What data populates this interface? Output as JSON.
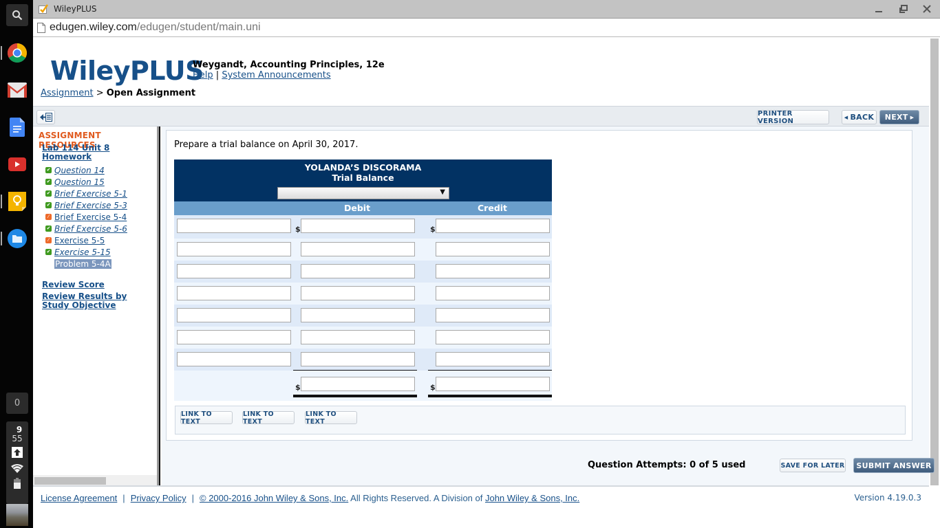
{
  "os_shelf": {
    "apps": [
      "Search",
      "Chrome",
      "Gmail",
      "Docs",
      "YouTube",
      "Keep",
      "Files"
    ],
    "notification_count": "0",
    "clock_hour": "9",
    "clock_minute": "55"
  },
  "window": {
    "tab_title": "WileyPLUS",
    "url_host": "edugen.wiley.com",
    "url_path": "/edugen/student/main.uni"
  },
  "header": {
    "logo": "WileyPLUS",
    "book_title": "Weygandt, Accounting Principles, 12e",
    "help_link": "Help",
    "link_separator": "|",
    "announcements_link": "System Announcements"
  },
  "breadcrumb": {
    "parent": "Assignment",
    "separator": ">",
    "current": "Open Assignment"
  },
  "toolbar": {
    "printer_version": "PRINTER VERSION",
    "back": "BACK",
    "next": "NEXT"
  },
  "sidebar": {
    "heading": "ASSIGNMENT RESOURCES",
    "assignment_title": "Lab 114 Unit 8 Homework",
    "items": [
      {
        "label": "Question 14",
        "status": "complete"
      },
      {
        "label": "Question 15",
        "status": "complete"
      },
      {
        "label": "Brief Exercise 5-1",
        "status": "complete"
      },
      {
        "label": "Brief Exercise 5-3",
        "status": "complete"
      },
      {
        "label": "Brief Exercise 5-4",
        "status": "partial"
      },
      {
        "label": "Brief Exercise 5-6",
        "status": "complete"
      },
      {
        "label": "Exercise 5-5",
        "status": "partial"
      },
      {
        "label": "Exercise 5-15",
        "status": "complete"
      },
      {
        "label": "Problem 5-4A",
        "status": "current"
      }
    ],
    "review_score": "Review Score",
    "review_results": "Review Results by Study Objective"
  },
  "question": {
    "prompt": "Prepare a trial balance on April 30, 2017.",
    "trial_balance": {
      "company": "YOLANDA’S DISCORAMA",
      "statement": "Trial Balance",
      "date_select_value": "",
      "columns": {
        "account": "",
        "debit": "Debit",
        "credit": "Credit"
      },
      "currency_symbol": "$",
      "rows": [
        {
          "account": "",
          "debit": "",
          "credit": ""
        },
        {
          "account": "",
          "debit": "",
          "credit": ""
        },
        {
          "account": "",
          "debit": "",
          "credit": ""
        },
        {
          "account": "",
          "debit": "",
          "credit": ""
        },
        {
          "account": "",
          "debit": "",
          "credit": ""
        },
        {
          "account": "",
          "debit": "",
          "credit": ""
        },
        {
          "account": "",
          "debit": "",
          "credit": ""
        }
      ],
      "totals": {
        "debit": "",
        "credit": ""
      }
    },
    "link_buttons": [
      "LINK TO TEXT",
      "LINK TO TEXT",
      "LINK TO TEXT"
    ]
  },
  "actions": {
    "attempts": "Question Attempts: 0 of 5 used",
    "save_for_later": "SAVE FOR LATER",
    "submit": "SUBMIT ANSWER"
  },
  "footer": {
    "license": "License Agreement",
    "privacy": "Privacy Policy",
    "sep": "|",
    "copyright_link": "© 2000-2016 John Wiley & Sons, Inc.",
    "rights_text": " All Rights Reserved. A Division of ",
    "division_link": "John Wiley & Sons, Inc.",
    "version": "Version 4.19.0.3"
  },
  "colors": {
    "brand_blue": "#175089",
    "table_header": "#023263",
    "column_header": "#6a9ecb",
    "resources_heading": "#e05a1e",
    "complete_check": "#3f9a1f",
    "partial_check": "#ee6a2a"
  }
}
